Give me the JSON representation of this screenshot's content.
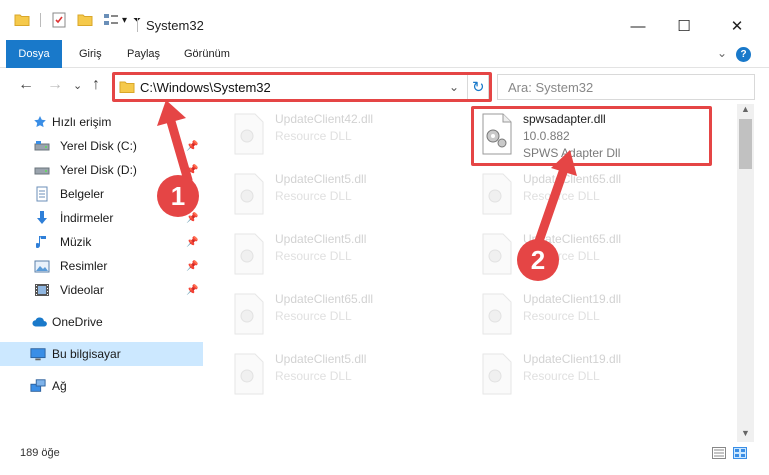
{
  "window": {
    "title": "System32",
    "minimize_glyph": "—",
    "maximize_glyph": "☐",
    "close_glyph": "✕"
  },
  "quick_access": {
    "dropdown_glyph": "▾",
    "customize_glyph": "⏷"
  },
  "ribbon": {
    "tabs": [
      "Dosya",
      "Giriş",
      "Paylaş",
      "Görünüm"
    ],
    "expand_glyph": "⌄",
    "help_glyph": "?"
  },
  "nav": {
    "back_glyph": "←",
    "forward_glyph": "→",
    "recent_glyph": "⌄",
    "up_glyph": "↑",
    "path": "C:\\Windows\\System32",
    "address_dropdown_glyph": "⌄",
    "refresh_glyph": "↻",
    "search_placeholder": "Ara: System32"
  },
  "sidebar": {
    "pin_glyph": "📌",
    "items": [
      {
        "label": "Hızlı erişim",
        "icon": "star-icon"
      },
      {
        "label": "Yerel Disk (C:)",
        "icon": "drive-icon"
      },
      {
        "label": "Yerel Disk (D:)",
        "icon": "drive-icon"
      },
      {
        "label": "Belgeler",
        "icon": "documents-icon"
      },
      {
        "label": "İndirmeler",
        "icon": "downloads-icon"
      },
      {
        "label": "Müzik",
        "icon": "music-icon"
      },
      {
        "label": "Resimler",
        "icon": "pictures-icon"
      },
      {
        "label": "Videolar",
        "icon": "videos-icon"
      },
      {
        "label": "OneDrive",
        "icon": "onedrive-icon"
      },
      {
        "label": "Bu bilgisayar",
        "icon": "computer-icon"
      },
      {
        "label": "Ağ",
        "icon": "network-icon"
      }
    ]
  },
  "files": {
    "left_column": [
      {
        "name": "UpdateClient42.dll",
        "desc": "Resource DLL"
      },
      {
        "name": "UpdateClient5.dll",
        "desc": "Resource DLL"
      },
      {
        "name": "UpdateClient5.dll",
        "desc": "Resource DLL"
      },
      {
        "name": "UpdateClient65.dll",
        "desc": "Resource DLL"
      },
      {
        "name": "UpdateClient5.dll",
        "desc": "Resource DLL"
      }
    ],
    "right_column": [
      {
        "name": "UpdateClient65.dll",
        "desc": "Resource DLL"
      },
      {
        "name": "UpdateClient65.dll",
        "desc": "Resource DLL"
      },
      {
        "name": "UpdateClient19.dll",
        "desc": "Resource DLL"
      },
      {
        "name": "UpdateClient19.dll",
        "desc": "Resource DLL"
      }
    ],
    "highlighted": {
      "name": "spwsadapter.dll",
      "version": "10.0.882",
      "desc": "SPWS Adapter Dll"
    }
  },
  "status": {
    "count": "189 öğe"
  },
  "callouts": {
    "step1": "1",
    "step2": "2",
    "color": "#e54545"
  }
}
